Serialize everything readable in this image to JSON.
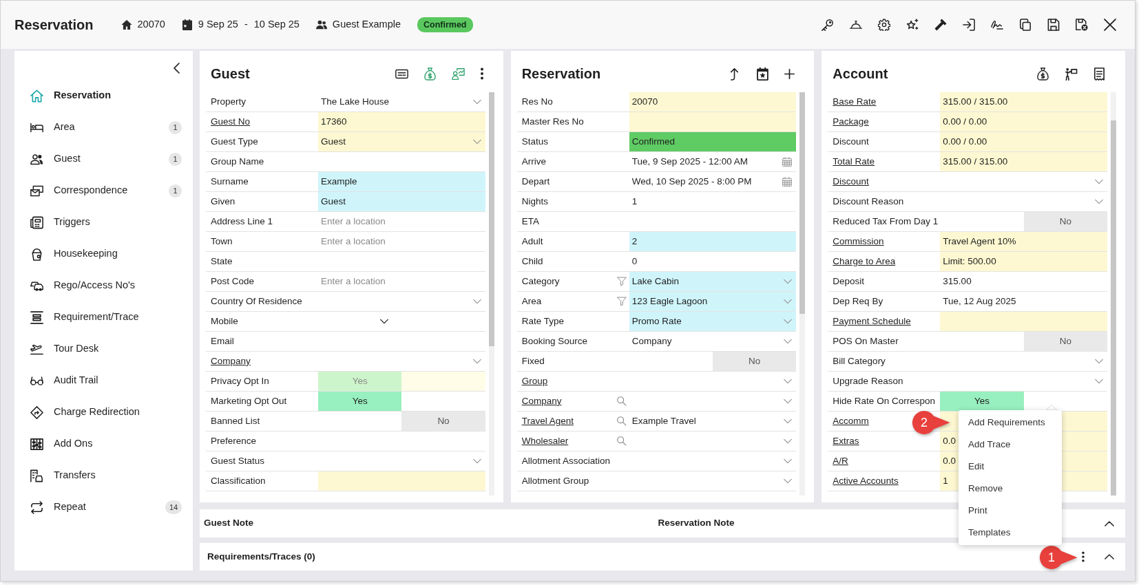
{
  "header": {
    "title": "Reservation",
    "res_no": "20070",
    "arrive": "9 Sep 25",
    "date_separator": "-",
    "depart": "10 Sep 25",
    "guest_name": "Guest Example",
    "status": "Confirmed"
  },
  "sidebar": {
    "items": [
      {
        "label": "Reservation",
        "selected": true
      },
      {
        "label": "Area",
        "selected": false,
        "count": "1"
      },
      {
        "label": "Guest",
        "selected": false,
        "count": "1"
      },
      {
        "label": "Correspondence",
        "selected": false,
        "count": "1"
      },
      {
        "label": "Triggers",
        "selected": false
      },
      {
        "label": "Housekeeping",
        "selected": false
      },
      {
        "label": "Rego/Access No's",
        "selected": false
      },
      {
        "label": "Requirement/Trace",
        "selected": false
      },
      {
        "label": "Tour Desk",
        "selected": false
      },
      {
        "label": "Audit Trail",
        "selected": false
      },
      {
        "label": "Charge Redirection",
        "selected": false
      },
      {
        "label": "Add Ons",
        "selected": false
      },
      {
        "label": "Transfers",
        "selected": false
      },
      {
        "label": "Repeat",
        "selected": false,
        "count": "14"
      }
    ]
  },
  "panels": [
    {
      "title": "Guest",
      "rows": [
        {
          "label": "Property",
          "link": false,
          "kind": "select",
          "value": "The Lake House"
        },
        {
          "label": "Guest No",
          "link": true,
          "kind": "text",
          "value": "17360",
          "color": "#fdf8d1"
        },
        {
          "label": "Guest Type",
          "link": false,
          "kind": "select",
          "value": "Guest",
          "color": "#fdf8d1"
        },
        {
          "label": "Group Name",
          "link": false,
          "kind": "text"
        },
        {
          "label": "Surname",
          "link": false,
          "kind": "text",
          "value": "Example",
          "color": "#cff5fb"
        },
        {
          "label": "Given",
          "link": false,
          "kind": "text",
          "value": "Guest",
          "color": "#cff5fb"
        },
        {
          "label": "Address Line 1",
          "link": false,
          "kind": "text",
          "placeholder": "Enter a location"
        },
        {
          "label": "Town",
          "link": false,
          "kind": "text",
          "placeholder": "Enter a location"
        },
        {
          "label": "State",
          "link": false,
          "kind": "text"
        },
        {
          "label": "Post Code",
          "link": false,
          "kind": "text",
          "placeholder": "Enter a location"
        },
        {
          "label": "Country Of Residence",
          "link": false,
          "kind": "select"
        },
        {
          "label": "Mobile",
          "link": false,
          "kind": "phone"
        },
        {
          "label": "Email",
          "link": false,
          "kind": "text"
        },
        {
          "label": "Company",
          "link": true,
          "kind": "select"
        },
        {
          "label": "Privacy Opt In",
          "link": false,
          "kind": "toggle",
          "on": true,
          "disabled": true,
          "value": "Yes"
        },
        {
          "label": "Marketing Opt Out",
          "link": false,
          "kind": "toggle",
          "on": true,
          "disabled": false,
          "value": "Yes"
        },
        {
          "label": "Banned List",
          "link": false,
          "kind": "toggle",
          "on": false,
          "disabled": false,
          "value": "No"
        },
        {
          "label": "Preference",
          "link": false,
          "kind": "text"
        },
        {
          "label": "Guest Status",
          "link": false,
          "kind": "select"
        },
        {
          "label": "Classification",
          "link": false,
          "kind": "text",
          "color": "#fdf8d1"
        }
      ]
    },
    {
      "title": "Reservation",
      "rows": [
        {
          "label": "Res No",
          "link": false,
          "filter": false,
          "search": false,
          "kind": "text",
          "value": "20070",
          "color": "#fdf8d1"
        },
        {
          "label": "Master Res No",
          "link": false,
          "filter": false,
          "search": false,
          "kind": "text",
          "color": "#fdf8d1"
        },
        {
          "label": "Status",
          "link": false,
          "filter": false,
          "search": false,
          "kind": "text",
          "value": "Confirmed",
          "color": "#5fcb63"
        },
        {
          "label": "Arrive",
          "link": false,
          "filter": false,
          "search": false,
          "kind": "date",
          "value": "Tue, 9 Sep 2025 - 12:00 AM"
        },
        {
          "label": "Depart",
          "link": false,
          "filter": false,
          "search": false,
          "kind": "date",
          "value": "Wed, 10 Sep 2025 - 8:00 PM"
        },
        {
          "label": "Nights",
          "link": false,
          "filter": false,
          "search": false,
          "kind": "text",
          "value": "1"
        },
        {
          "label": "ETA",
          "link": false,
          "filter": false,
          "search": false,
          "kind": "text"
        },
        {
          "label": "Adult",
          "link": false,
          "filter": false,
          "search": false,
          "kind": "text",
          "value": "2",
          "color": "#cff5fb"
        },
        {
          "label": "Child",
          "link": false,
          "filter": false,
          "search": false,
          "kind": "text",
          "value": "0"
        },
        {
          "label": "Category",
          "link": false,
          "filter": true,
          "search": false,
          "kind": "select",
          "value": "Lake Cabin",
          "color": "#cff5fb"
        },
        {
          "label": "Area",
          "link": false,
          "filter": true,
          "search": false,
          "kind": "select",
          "value": "123 Eagle Lagoon",
          "color": "#cff5fb"
        },
        {
          "label": "Rate Type",
          "link": false,
          "filter": false,
          "search": false,
          "kind": "select",
          "value": "Promo Rate",
          "color": "#cff5fb"
        },
        {
          "label": "Booking Source",
          "link": false,
          "filter": false,
          "search": false,
          "kind": "select",
          "value": "Company"
        },
        {
          "label": "Fixed",
          "link": false,
          "filter": false,
          "search": false,
          "kind": "toggle",
          "on": false,
          "disabled": false,
          "value": "No"
        },
        {
          "label": "Group",
          "link": true,
          "filter": false,
          "search": false,
          "kind": "select"
        },
        {
          "label": "Company",
          "link": true,
          "filter": false,
          "search": true,
          "kind": "select"
        },
        {
          "label": "Travel Agent",
          "link": true,
          "filter": false,
          "search": true,
          "kind": "select",
          "value": "Example Travel"
        },
        {
          "label": "Wholesaler",
          "link": true,
          "filter": false,
          "search": true,
          "kind": "select"
        },
        {
          "label": "Allotment Association",
          "link": false,
          "filter": false,
          "search": false,
          "kind": "select"
        },
        {
          "label": "Allotment Group",
          "link": false,
          "filter": false,
          "search": false,
          "kind": "select"
        }
      ]
    },
    {
      "title": "Account",
      "rows": [
        {
          "label": "Base Rate",
          "link": true,
          "kind": "text",
          "value": "315.00 / 315.00",
          "color": "#fdf8d1"
        },
        {
          "label": "Package",
          "link": true,
          "kind": "text",
          "value": "0.00 / 0.00",
          "color": "#fdf8d1"
        },
        {
          "label": "Discount",
          "link": false,
          "kind": "text",
          "value": "0.00 / 0.00",
          "color": "#fdf8d1"
        },
        {
          "label": "Total Rate",
          "link": true,
          "kind": "text",
          "value": "315.00 / 315.00",
          "color": "#fdf8d1"
        },
        {
          "label": "Discount",
          "link": true,
          "kind": "select"
        },
        {
          "label": "Discount Reason",
          "link": false,
          "kind": "select"
        },
        {
          "label": "Reduced Tax From Day 1",
          "link": false,
          "kind": "toggle",
          "on": false,
          "disabled": false,
          "value": "No"
        },
        {
          "label": "Commission",
          "link": true,
          "kind": "text",
          "value": "Travel Agent 10%",
          "color": "#fdf8d1"
        },
        {
          "label": "Charge to Area",
          "link": true,
          "kind": "text",
          "value": "Limit: 500.00",
          "color": "#fdf8d1"
        },
        {
          "label": "Deposit",
          "link": false,
          "kind": "text",
          "value": "315.00"
        },
        {
          "label": "Dep Req By",
          "link": false,
          "kind": "text",
          "value": "Tue, 12 Aug 2025"
        },
        {
          "label": "Payment Schedule",
          "link": true,
          "kind": "text",
          "color": "#fdf8d1"
        },
        {
          "label": "POS On Master",
          "link": false,
          "kind": "toggle",
          "on": false,
          "disabled": false,
          "value": "No"
        },
        {
          "label": "Bill Category",
          "link": false,
          "kind": "select"
        },
        {
          "label": "Upgrade Reason",
          "link": false,
          "kind": "select"
        },
        {
          "label": "Hide Rate On Correspon",
          "link": false,
          "kind": "toggle",
          "on": true,
          "disabled": false,
          "value": "Yes"
        },
        {
          "label": "Accomm",
          "link": true,
          "kind": "text",
          "color": "#fdf8d1"
        },
        {
          "label": "Extras",
          "link": true,
          "kind": "text",
          "value": "0.0",
          "color": "#fdf8d1"
        },
        {
          "label": "A/R",
          "link": true,
          "kind": "text",
          "value": "0.0",
          "color": "#fdf8d1"
        },
        {
          "label": "Active Accounts",
          "link": true,
          "kind": "text",
          "value": "1",
          "color": "#fdf8d1"
        }
      ]
    }
  ],
  "notes_bar": {
    "guest_note": "Guest Note",
    "reservation_note": "Reservation Note"
  },
  "requirements_bar": {
    "title": "Requirements/Traces (0)",
    "callout": "1"
  },
  "context_menu": {
    "items": [
      "Add Requirements",
      "Add Trace",
      "Edit",
      "Remove",
      "Print",
      "Templates"
    ],
    "callout": "2"
  }
}
